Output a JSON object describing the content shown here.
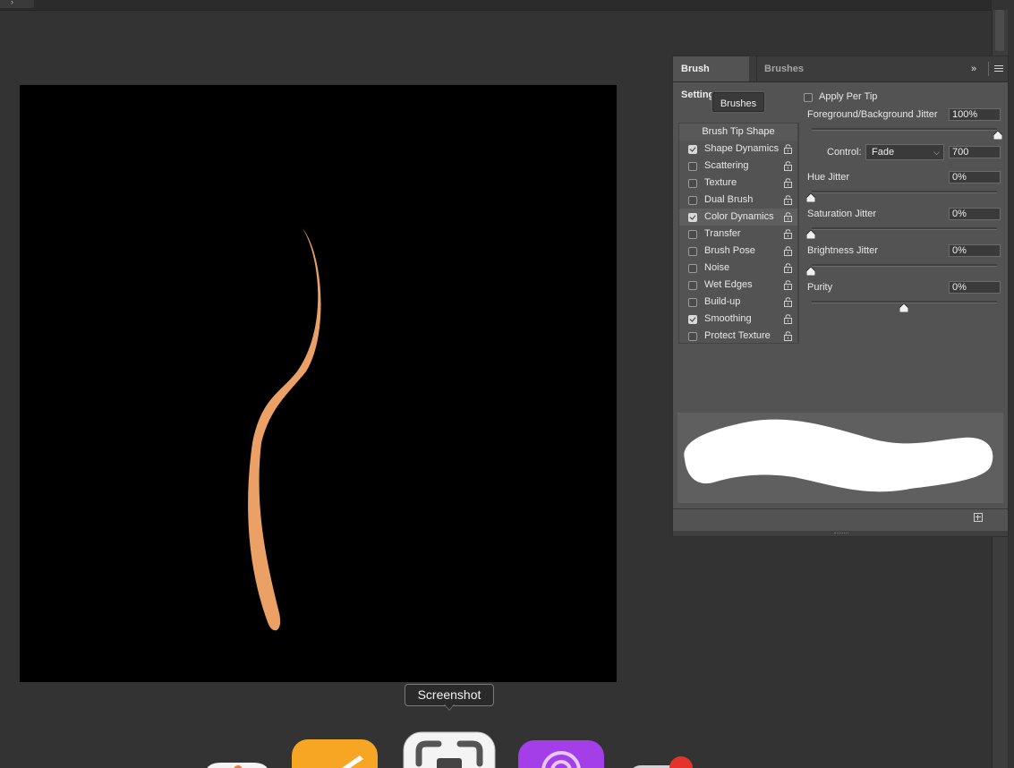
{
  "panel": {
    "tabs": [
      {
        "label": "Brush Settings",
        "active": true
      },
      {
        "label": "Brushes",
        "active": false
      }
    ],
    "brushes_button": "Brushes",
    "options_header": "Brush Tip Shape",
    "options": [
      {
        "label": "Shape Dynamics",
        "checked": true
      },
      {
        "label": "Scattering",
        "checked": false
      },
      {
        "label": "Texture",
        "checked": false
      },
      {
        "label": "Dual Brush",
        "checked": false
      },
      {
        "label": "Color Dynamics",
        "checked": true,
        "selected": true
      },
      {
        "label": "Transfer",
        "checked": false
      },
      {
        "label": "Brush Pose",
        "checked": false
      },
      {
        "label": "Noise",
        "checked": false
      },
      {
        "label": "Wet Edges",
        "checked": false
      },
      {
        "label": "Build-up",
        "checked": false
      },
      {
        "label": "Smoothing",
        "checked": true
      },
      {
        "label": "Protect Texture",
        "checked": false
      }
    ],
    "apply_per_tip": {
      "label": "Apply Per Tip",
      "checked": false
    },
    "fg_bg_jitter": {
      "label": "Foreground/Background Jitter",
      "value": "100%",
      "level": 1.0
    },
    "control": {
      "label": "Control:",
      "selected": "Fade",
      "value": "700"
    },
    "hue_jitter": {
      "label": "Hue Jitter",
      "value": "0%",
      "level": 0.0
    },
    "saturation_jitter": {
      "label": "Saturation Jitter",
      "value": "0%",
      "level": 0.0
    },
    "brightness_jitter": {
      "label": "Brightness Jitter",
      "value": "0%",
      "level": 0.0
    },
    "purity": {
      "label": "Purity",
      "value": "0%",
      "level": 0.5
    }
  },
  "tooltip": {
    "text": "Screenshot"
  },
  "colors": {
    "stroke": "#eba166",
    "canvas": "#000000",
    "panel": "#535353",
    "background": "#333333"
  },
  "dock": {
    "icons": [
      "reminders-icon",
      "pages-icon",
      "screenshot-icon",
      "podcasts-icon",
      "mail-icon"
    ],
    "badge": ""
  }
}
